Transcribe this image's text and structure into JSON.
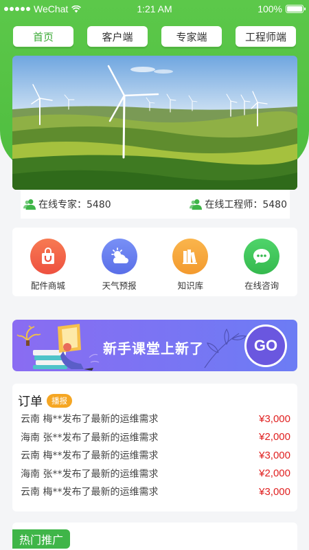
{
  "status_bar": {
    "carrier": "WeChat",
    "time": "1:21 AM",
    "battery": "100%"
  },
  "tabs": [
    {
      "label": "首页",
      "active": true
    },
    {
      "label": "客户端",
      "active": false
    },
    {
      "label": "专家端",
      "active": false
    },
    {
      "label": "工程师端",
      "active": false
    }
  ],
  "stats": {
    "experts": "在线专家：5480",
    "engineers": "在线工程师：5480"
  },
  "features": [
    {
      "label": "配件商城",
      "icon": "shopping-bag-icon",
      "color": "#f2664a"
    },
    {
      "label": "天气预报",
      "icon": "weather-icon",
      "color": "#5f7ff3"
    },
    {
      "label": "知识库",
      "icon": "books-icon",
      "color": "#f6a13a"
    },
    {
      "label": "在线咨询",
      "icon": "chat-icon",
      "color": "#3ec65c"
    }
  ],
  "promo": {
    "text": "新手课堂上新了",
    "button": "GO"
  },
  "orders": {
    "title": "订单",
    "badge": "播报",
    "items": [
      {
        "text": "云南 梅**发布了最新的运维需求",
        "price": "¥3,000"
      },
      {
        "text": "海南 张**发布了最新的运维需求",
        "price": "¥2,000"
      },
      {
        "text": "云南 梅**发布了最新的运维需求",
        "price": "¥3,000"
      },
      {
        "text": "海南 张**发布了最新的运维需求",
        "price": "¥2,000"
      },
      {
        "text": "云南 梅**发布了最新的运维需求",
        "price": "¥3,000"
      }
    ]
  },
  "hot": {
    "title": "热门推广"
  },
  "colors": {
    "brand_green": "#4fbd3f",
    "price_red": "#e02020",
    "badge_orange": "#f5a623"
  }
}
